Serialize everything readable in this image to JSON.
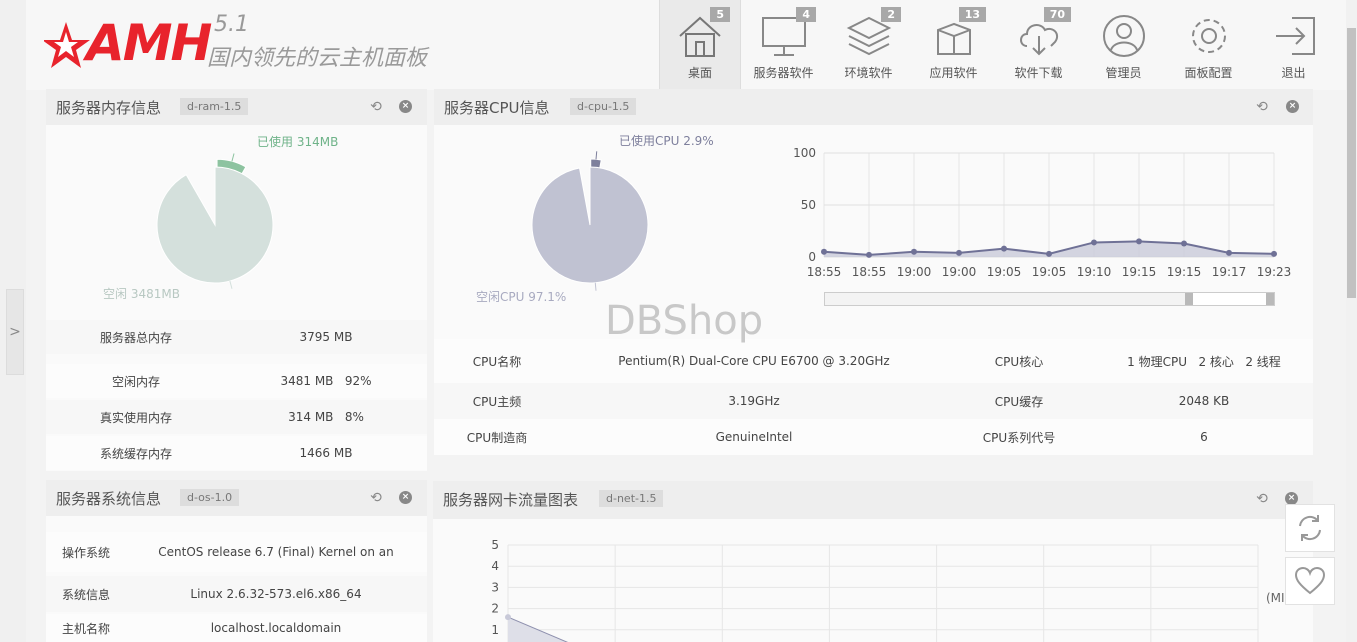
{
  "app": {
    "logo_text": "AMH",
    "version": "5.1",
    "slogan": "国内领先的云主机面板"
  },
  "nav": {
    "items": [
      {
        "label": "桌面",
        "count": "5",
        "icon": "home-icon"
      },
      {
        "label": "服务器软件",
        "count": "4",
        "icon": "monitor-icon"
      },
      {
        "label": "环境软件",
        "count": "2",
        "icon": "layers-icon"
      },
      {
        "label": "应用软件",
        "count": "13",
        "icon": "box-icon"
      },
      {
        "label": "软件下载",
        "count": "70",
        "icon": "cloud-download-icon"
      },
      {
        "label": "管理员",
        "count": "",
        "icon": "user-icon"
      },
      {
        "label": "面板配置",
        "count": "",
        "icon": "gear-icon"
      },
      {
        "label": "退出",
        "count": "",
        "icon": "logout-icon"
      }
    ]
  },
  "ram_panel": {
    "title": "服务器内存信息",
    "tag": "d-ram-1.5",
    "used_label": "已使用 314MB",
    "free_label": "空闲 3481MB",
    "used_fraction": 0.083,
    "rows": [
      {
        "label": "服务器总内存",
        "value": "3795 MB"
      },
      {
        "label": "空闲内存",
        "value": "3481 MB   92%"
      },
      {
        "label": "真实使用内存",
        "value": "314 MB   8%"
      },
      {
        "label": "系统缓存内存",
        "value": "1466 MB"
      }
    ]
  },
  "cpu_panel": {
    "title": "服务器CPU信息",
    "tag": "d-cpu-1.5",
    "used_label": "已使用CPU 2.9%",
    "free_label": "空闲CPU 97.1%",
    "used_fraction": 0.029,
    "rows": [
      {
        "k1": "CPU名称",
        "v1": "Pentium(R) Dual-Core CPU E6700 @ 3.20GHz",
        "k2": "CPU核心",
        "v2": "1 物理CPU   2 核心   2 线程"
      },
      {
        "k1": "CPU主频",
        "v1": "3.19GHz",
        "k2": "CPU缓存",
        "v2": "2048 KB"
      },
      {
        "k1": "CPU制造商",
        "v1": "GenuineIntel",
        "k2": "CPU系列代号",
        "v2": "6"
      }
    ]
  },
  "os_panel": {
    "title": "服务器系统信息",
    "tag": "d-os-1.0",
    "rows": [
      {
        "label": "操作系统",
        "value": "CentOS release 6.7 (Final) Kernel on an"
      },
      {
        "label": "系统信息",
        "value": "Linux 2.6.32-573.el6.x86_64"
      },
      {
        "label": "主机名称",
        "value": "localhost.localdomain"
      }
    ]
  },
  "net_panel": {
    "title": "服务器网卡流量图表",
    "tag": "d-net-1.5",
    "unit_text": "(MI"
  },
  "watermark": "DBShop",
  "chart_data": [
    {
      "type": "pie",
      "labels": [
        "已使用 314MB",
        "空闲 3481MB"
      ],
      "values": [
        314,
        3481
      ],
      "colors": [
        "#8dc3a0",
        "#d4e0dc"
      ]
    },
    {
      "type": "pie",
      "labels": [
        "已使用CPU 2.9%",
        "空闲CPU 97.1%"
      ],
      "values": [
        2.9,
        97.1
      ],
      "colors": [
        "#7d7f9c",
        "#c0c2d2"
      ]
    },
    {
      "type": "area",
      "x": [
        "18:55",
        "18:55",
        "19:00",
        "19:00",
        "19:05",
        "19:05",
        "19:10",
        "19:15",
        "19:15",
        "19:17",
        "19:23"
      ],
      "values": [
        5,
        2,
        5,
        4,
        8,
        3,
        14,
        15,
        13,
        4,
        3
      ],
      "ylim": [
        0,
        100
      ],
      "yticks": [
        0,
        50,
        100
      ],
      "colors": [
        "#6f7196"
      ]
    },
    {
      "type": "area",
      "x": [],
      "values": [
        1.6
      ],
      "ylim": [
        0,
        5
      ],
      "yticks": [
        1,
        2,
        3,
        4,
        5
      ],
      "colors": [
        "#8e90ae"
      ]
    }
  ]
}
